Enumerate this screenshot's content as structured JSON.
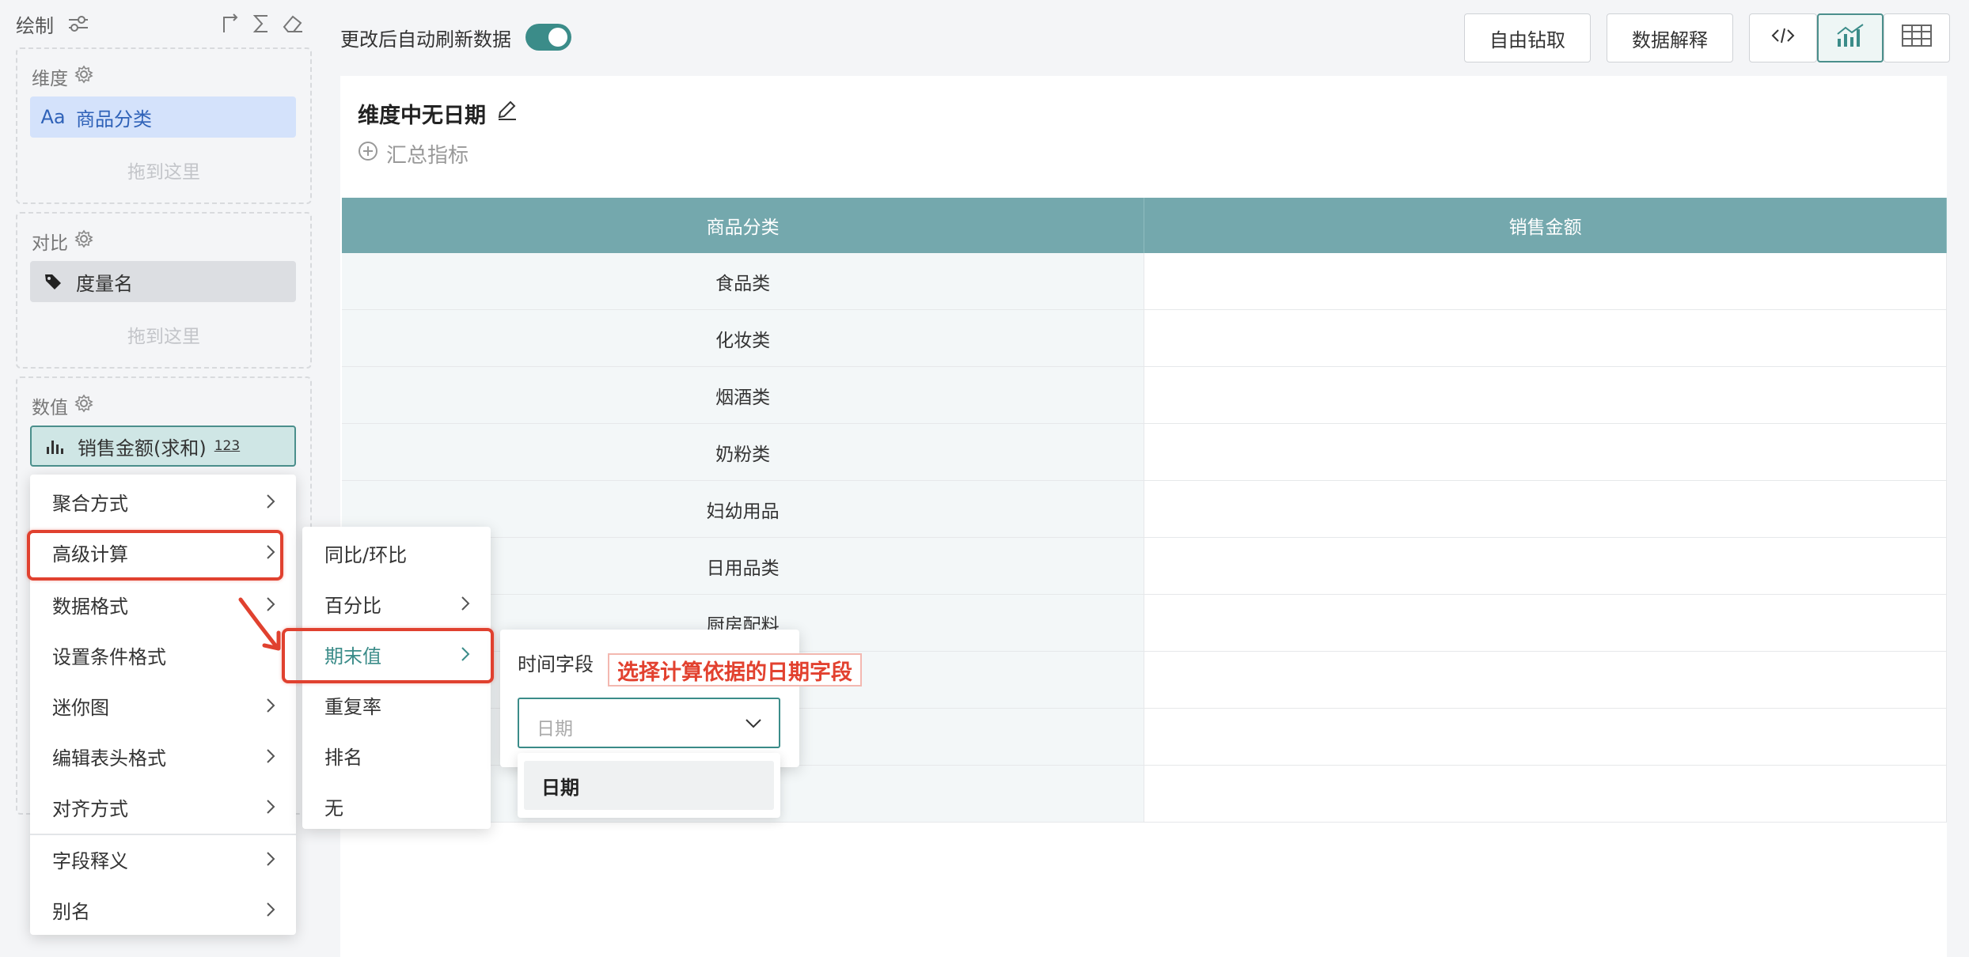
{
  "left": {
    "panel_title": "绘制",
    "dimension": {
      "label": "维度",
      "field": "商品分类",
      "field_type_icon": "Aa",
      "drop_hint": "拖到这里"
    },
    "compare": {
      "label": "对比",
      "field": "度量名",
      "drop_hint": "拖到这里"
    },
    "values": {
      "label": "数值",
      "field": "销售金额(求和)",
      "field_badge": "123"
    }
  },
  "topbar": {
    "auto_refresh_label": "更改后自动刷新数据",
    "auto_refresh_on": true,
    "drill_button": "自由钻取",
    "explain_button": "数据解释"
  },
  "content": {
    "title": "维度中无日期",
    "add_metric": "汇总指标"
  },
  "table": {
    "headers": [
      "商品分类",
      "销售金额"
    ],
    "rows": [
      "食品类",
      "化妆类",
      "烟酒类",
      "奶粉类",
      "妇幼用品",
      "日用品类",
      "厨房配料",
      "",
      "",
      ""
    ]
  },
  "menu1": {
    "items": [
      {
        "label": "聚合方式"
      },
      {
        "label": "高级计算"
      },
      {
        "label": "数据格式"
      },
      {
        "label": "设置条件格式"
      },
      {
        "label": "迷你图"
      },
      {
        "label": "编辑表头格式"
      },
      {
        "label": "对齐方式"
      },
      {
        "label": "字段释义"
      },
      {
        "label": "别名"
      }
    ]
  },
  "menu2": {
    "items": [
      {
        "label": "同比/环比"
      },
      {
        "label": "百分比"
      },
      {
        "label": "期末值"
      },
      {
        "label": "重复率"
      },
      {
        "label": "排名"
      },
      {
        "label": "无"
      }
    ]
  },
  "time_field": {
    "label": "时间字段",
    "annotation": "选择计算依据的日期字段",
    "placeholder": "日期",
    "option": "日期"
  },
  "colors": {
    "accent": "#3b8c89",
    "header": "#74a8ad",
    "highlight": "#e0412f"
  }
}
